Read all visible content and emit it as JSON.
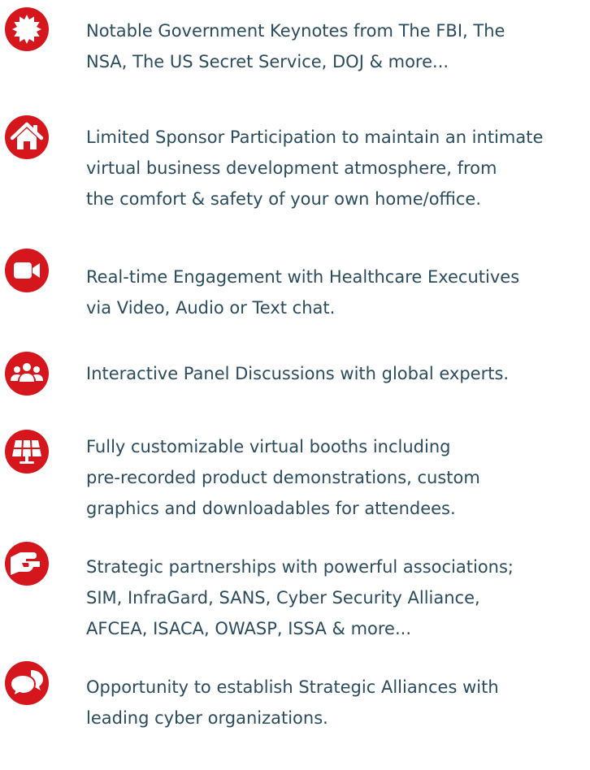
{
  "theme": {
    "icon_color": "#d5161c",
    "text_color": "#2b4c5e"
  },
  "features": [
    {
      "icon": "award-badge-icon",
      "lines": [
        "Notable Government Keynotes from The FBI, The",
        "NSA, The US Secret Service, DOJ & more..."
      ]
    },
    {
      "icon": "home-icon",
      "lines": [
        "Limited Sponsor Participation to maintain an intimate",
        "virtual business development atmosphere, from",
        "the comfort & safety of your own home/office."
      ]
    },
    {
      "icon": "video-camera-icon",
      "lines": [
        "Real-time Engagement with Healthcare Executives",
        "via Video, Audio or Text chat."
      ]
    },
    {
      "icon": "users-group-icon",
      "lines": [
        "Interactive Panel Discussions with global experts."
      ]
    },
    {
      "icon": "solar-panel-icon",
      "lines": [
        "Fully customizable virtual booths including",
        "pre-recorded product demonstrations, custom",
        "graphics and downloadables for attendees."
      ]
    },
    {
      "icon": "handshake-icon",
      "lines": [
        "Strategic partnerships with powerful associations;",
        "SIM, InfraGard, SANS, Cyber Security Alliance,",
        "AFCEA, ISACA, OWASP, ISSA & more..."
      ]
    },
    {
      "icon": "chat-bubbles-icon",
      "lines": [
        "Opportunity to establish Strategic Alliances with",
        "leading cyber organizations."
      ]
    }
  ]
}
